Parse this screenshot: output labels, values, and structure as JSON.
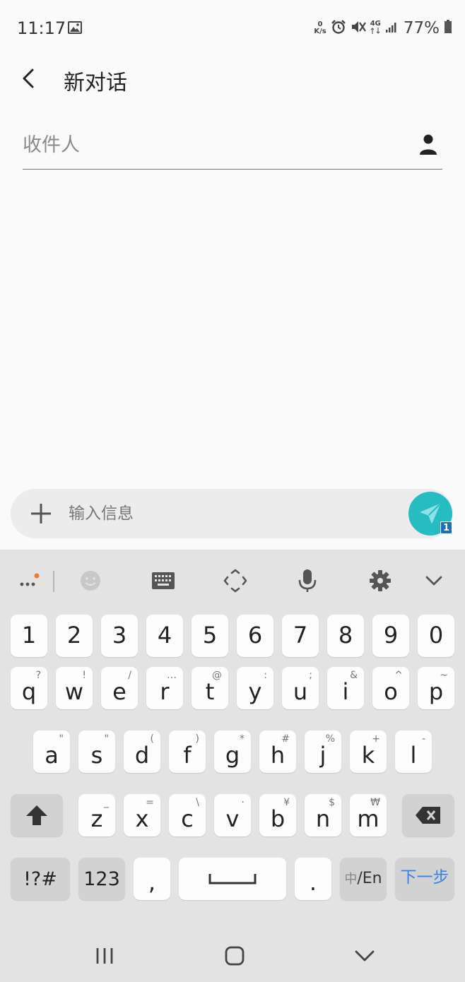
{
  "status_bar": {
    "time": "11:17",
    "net_speed_value": "0",
    "net_speed_unit": "K/s",
    "network_type": "4G",
    "battery": "77%"
  },
  "header": {
    "title": "新对话"
  },
  "recipient": {
    "placeholder": "收件人"
  },
  "composer": {
    "placeholder": "输入信息",
    "sim_badge": "1",
    "send_color": "#25bcc2"
  },
  "keyboard": {
    "toolbar_icons": [
      "more-icon",
      "emoji-icon",
      "keyboard-icon",
      "move-cursor-icon",
      "microphone-icon",
      "settings-icon",
      "collapse-icon"
    ],
    "number_row": [
      "1",
      "2",
      "3",
      "4",
      "5",
      "6",
      "7",
      "8",
      "9",
      "0"
    ],
    "row1": [
      {
        "key": "q",
        "hint": "?"
      },
      {
        "key": "w",
        "hint": "!"
      },
      {
        "key": "e",
        "hint": "/"
      },
      {
        "key": "r",
        "hint": "…"
      },
      {
        "key": "t",
        "hint": "@"
      },
      {
        "key": "y",
        "hint": ":"
      },
      {
        "key": "u",
        "hint": ";"
      },
      {
        "key": "i",
        "hint": "&"
      },
      {
        "key": "o",
        "hint": "^"
      },
      {
        "key": "p",
        "hint": "~"
      }
    ],
    "row2": [
      {
        "key": "a",
        "hint": "\""
      },
      {
        "key": "s",
        "hint": "\""
      },
      {
        "key": "d",
        "hint": "("
      },
      {
        "key": "f",
        "hint": ")"
      },
      {
        "key": "g",
        "hint": "*"
      },
      {
        "key": "h",
        "hint": "#"
      },
      {
        "key": "j",
        "hint": "%"
      },
      {
        "key": "k",
        "hint": "+"
      },
      {
        "key": "l",
        "hint": "-"
      }
    ],
    "row3": [
      {
        "key": "z",
        "hint": "_"
      },
      {
        "key": "x",
        "hint": "="
      },
      {
        "key": "c",
        "hint": "\\"
      },
      {
        "key": "v",
        "hint": "·"
      },
      {
        "key": "b",
        "hint": "¥"
      },
      {
        "key": "n",
        "hint": "$"
      },
      {
        "key": "m",
        "hint": "₩"
      }
    ],
    "symbols_label": "!?#",
    "numbers_label": "123",
    "comma_label": ",",
    "period_label": ".",
    "lang_zh": "中",
    "lang_en": "/En",
    "next_label": "下一步",
    "accent_color": "#3a82e6"
  }
}
